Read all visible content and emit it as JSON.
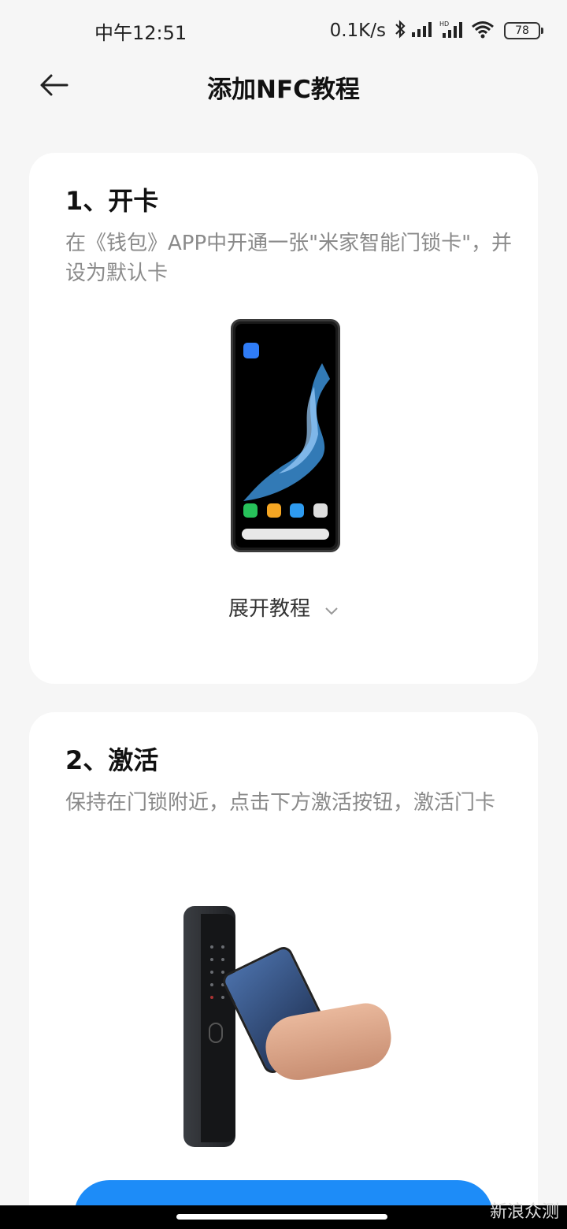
{
  "status_bar": {
    "time": "中午12:51",
    "network_speed": "0.1K/s",
    "battery": "78",
    "icons": [
      "bluetooth-icon",
      "signal-icon",
      "hd-signal-icon",
      "wifi-icon",
      "battery-icon"
    ]
  },
  "header": {
    "title": "添加NFC教程",
    "back_icon": "arrow-left-icon"
  },
  "steps": [
    {
      "title": "1、开卡",
      "description": "在《钱包》APP中开通一张\"米家智能门锁卡\"，并设为默认卡",
      "expand_label": "展开教程",
      "expand_icon": "chevron-down-icon"
    },
    {
      "title": "2、激活",
      "description": "保持在门锁附近，点击下方激活按钮，激活门卡"
    }
  ],
  "colors": {
    "accent": "#1d8cf8",
    "background": "#f6f6f6",
    "card": "#ffffff",
    "secondary_text": "#8a8a8a"
  },
  "watermark": "新浪众测"
}
